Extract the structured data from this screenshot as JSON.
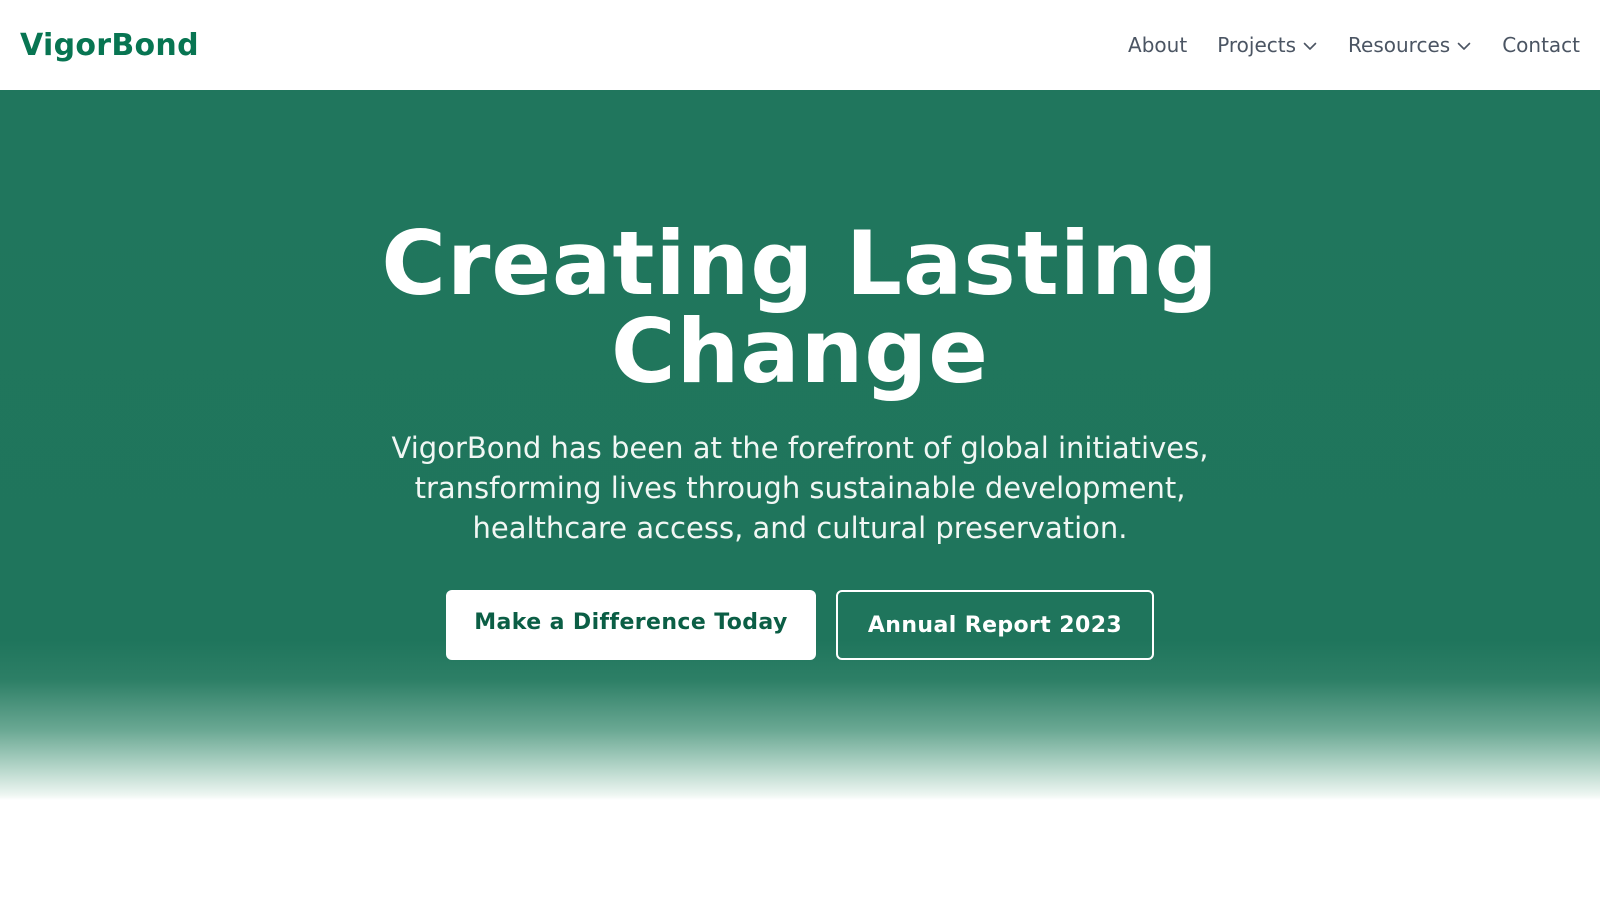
{
  "brand": {
    "name": "VigorBond",
    "color": "#087552"
  },
  "nav": {
    "items": [
      {
        "label": "About",
        "has_dropdown": false
      },
      {
        "label": "Projects",
        "has_dropdown": true,
        "icon": "chevron-down-icon"
      },
      {
        "label": "Resources",
        "has_dropdown": true,
        "icon": "chevron-down-icon"
      },
      {
        "label": "Contact",
        "has_dropdown": false
      }
    ]
  },
  "hero": {
    "title_line1": "Creating Lasting",
    "title_line2": "Change",
    "subtitle_line1": "VigorBond has been at the forefront of global initiatives,",
    "subtitle_line2": "transforming lives through sustainable development,",
    "subtitle_line3": "healthcare access, and cultural preservation.",
    "background_color": "#1f755c",
    "primary_button": "Make a Difference Today",
    "secondary_button": "Annual Report 2023"
  }
}
